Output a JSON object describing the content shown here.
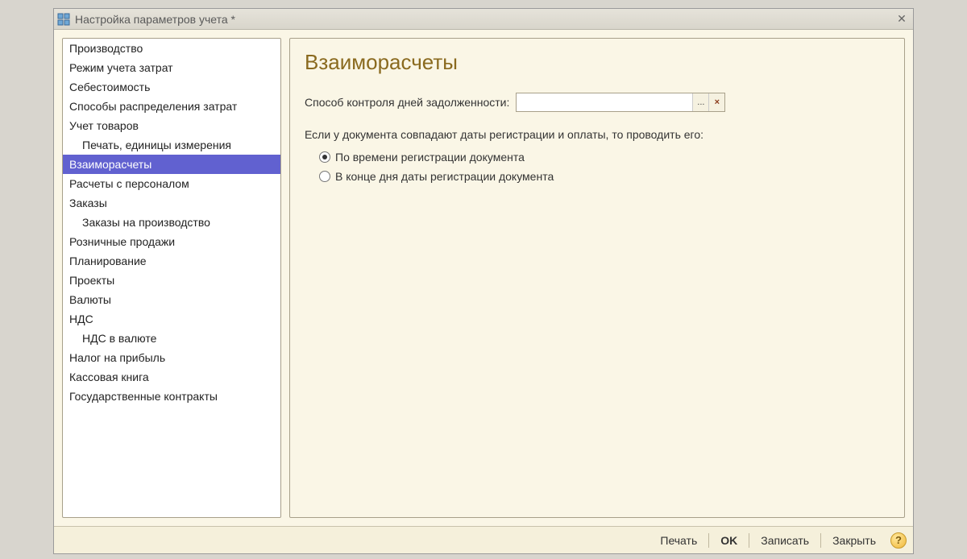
{
  "window": {
    "title": "Настройка параметров учета *"
  },
  "sidebar": {
    "items": [
      {
        "label": "Производство",
        "indent": false
      },
      {
        "label": "Режим учета затрат",
        "indent": false
      },
      {
        "label": "Себестоимость",
        "indent": false
      },
      {
        "label": "Способы распределения затрат",
        "indent": false
      },
      {
        "label": "Учет товаров",
        "indent": false
      },
      {
        "label": "Печать, единицы измерения",
        "indent": true
      },
      {
        "label": "Взаиморасчеты",
        "indent": false,
        "selected": true
      },
      {
        "label": "Расчеты с персоналом",
        "indent": false
      },
      {
        "label": "Заказы",
        "indent": false
      },
      {
        "label": "Заказы на производство",
        "indent": true
      },
      {
        "label": "Розничные продажи",
        "indent": false
      },
      {
        "label": "Планирование",
        "indent": false
      },
      {
        "label": "Проекты",
        "indent": false
      },
      {
        "label": "Валюты",
        "indent": false
      },
      {
        "label": "НДС",
        "indent": false
      },
      {
        "label": "НДС в валюте",
        "indent": true
      },
      {
        "label": "Налог на прибыль",
        "indent": false
      },
      {
        "label": "Кассовая книга",
        "indent": false
      },
      {
        "label": "Государственные контракты",
        "indent": false
      }
    ]
  },
  "main": {
    "title": "Взаиморасчеты",
    "field_label": "Способ контроля дней задолженности:",
    "field_value": "",
    "select_btn": "...",
    "clear_btn": "×",
    "info_text": "Если у документа совпадают даты регистрации и оплаты, то проводить его:",
    "radio1": "По времени регистрации документа",
    "radio2": "В конце дня даты регистрации документа"
  },
  "footer": {
    "print": "Печать",
    "ok": "OK",
    "save": "Записать",
    "close": "Закрыть",
    "help": "?"
  }
}
